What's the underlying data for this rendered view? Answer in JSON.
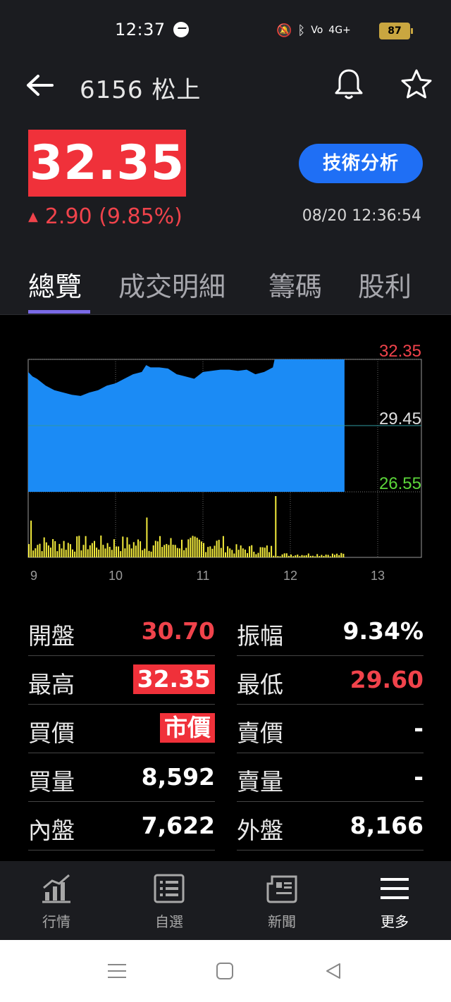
{
  "status_bar": {
    "time": "12:37",
    "battery": "87",
    "network": "4G+"
  },
  "header": {
    "title": "6156 松上"
  },
  "quote": {
    "price": "32.35",
    "change": "2.90 (9.85%)",
    "timestamp": "08/20 12:36:54",
    "analysis_button": "技術分析",
    "up_color": "#f0434b"
  },
  "tabs": [
    "總覽",
    "成交明細",
    "籌碼",
    "股利"
  ],
  "chart_data": {
    "type": "area",
    "y_labels": {
      "high": "32.35",
      "ref": "29.45",
      "low": "26.55"
    },
    "x_ticks": [
      "9",
      "10",
      "11",
      "12",
      "13"
    ],
    "ylim": [
      26.55,
      32.35
    ],
    "reference": 29.45,
    "price_series": [
      {
        "t": 9.0,
        "p": 31.8
      },
      {
        "t": 9.05,
        "p": 31.6
      },
      {
        "t": 9.1,
        "p": 31.5
      },
      {
        "t": 9.2,
        "p": 31.2
      },
      {
        "t": 9.3,
        "p": 31.0
      },
      {
        "t": 9.4,
        "p": 30.9
      },
      {
        "t": 9.5,
        "p": 30.8
      },
      {
        "t": 9.6,
        "p": 30.75
      },
      {
        "t": 9.7,
        "p": 30.9
      },
      {
        "t": 9.8,
        "p": 31.0
      },
      {
        "t": 9.9,
        "p": 31.2
      },
      {
        "t": 10.0,
        "p": 31.3
      },
      {
        "t": 10.1,
        "p": 31.5
      },
      {
        "t": 10.2,
        "p": 31.7
      },
      {
        "t": 10.3,
        "p": 31.8
      },
      {
        "t": 10.35,
        "p": 32.1
      },
      {
        "t": 10.4,
        "p": 32.0
      },
      {
        "t": 10.5,
        "p": 32.0
      },
      {
        "t": 10.6,
        "p": 31.95
      },
      {
        "t": 10.7,
        "p": 31.7
      },
      {
        "t": 10.8,
        "p": 31.6
      },
      {
        "t": 10.9,
        "p": 31.5
      },
      {
        "t": 11.0,
        "p": 31.8
      },
      {
        "t": 11.1,
        "p": 31.85
      },
      {
        "t": 11.2,
        "p": 31.9
      },
      {
        "t": 11.3,
        "p": 31.9
      },
      {
        "t": 11.4,
        "p": 31.85
      },
      {
        "t": 11.5,
        "p": 31.9
      },
      {
        "t": 11.6,
        "p": 31.7
      },
      {
        "t": 11.7,
        "p": 31.8
      },
      {
        "t": 11.8,
        "p": 32.0
      },
      {
        "t": 11.82,
        "p": 32.35
      },
      {
        "t": 12.62,
        "p": 32.35
      }
    ],
    "volume_peaks": [
      {
        "t": 10.35,
        "v": 0.65
      },
      {
        "t": 11.82,
        "v": 1.0
      },
      {
        "t": 9.02,
        "v": 0.6
      }
    ]
  },
  "stats": [
    {
      "label": "開盤",
      "value": "30.70",
      "style": "red"
    },
    {
      "label": "振幅",
      "value": "9.34%",
      "style": "white"
    },
    {
      "label": "最高",
      "value": "32.35",
      "style": "box"
    },
    {
      "label": "最低",
      "value": "29.60",
      "style": "red"
    },
    {
      "label": "買價",
      "value": "市價",
      "style": "box"
    },
    {
      "label": "賣價",
      "value": "-",
      "style": "white"
    },
    {
      "label": "買量",
      "value": "8,592",
      "style": "white"
    },
    {
      "label": "賣量",
      "value": "-",
      "style": "white"
    },
    {
      "label": "內盤",
      "value": "7,622",
      "style": "white"
    },
    {
      "label": "外盤",
      "value": "8,166",
      "style": "white"
    }
  ],
  "bottom_nav": [
    {
      "label": "行情",
      "icon": "chart-icon"
    },
    {
      "label": "自選",
      "icon": "list-icon"
    },
    {
      "label": "新聞",
      "icon": "news-icon"
    },
    {
      "label": "更多",
      "icon": "menu-icon"
    }
  ]
}
